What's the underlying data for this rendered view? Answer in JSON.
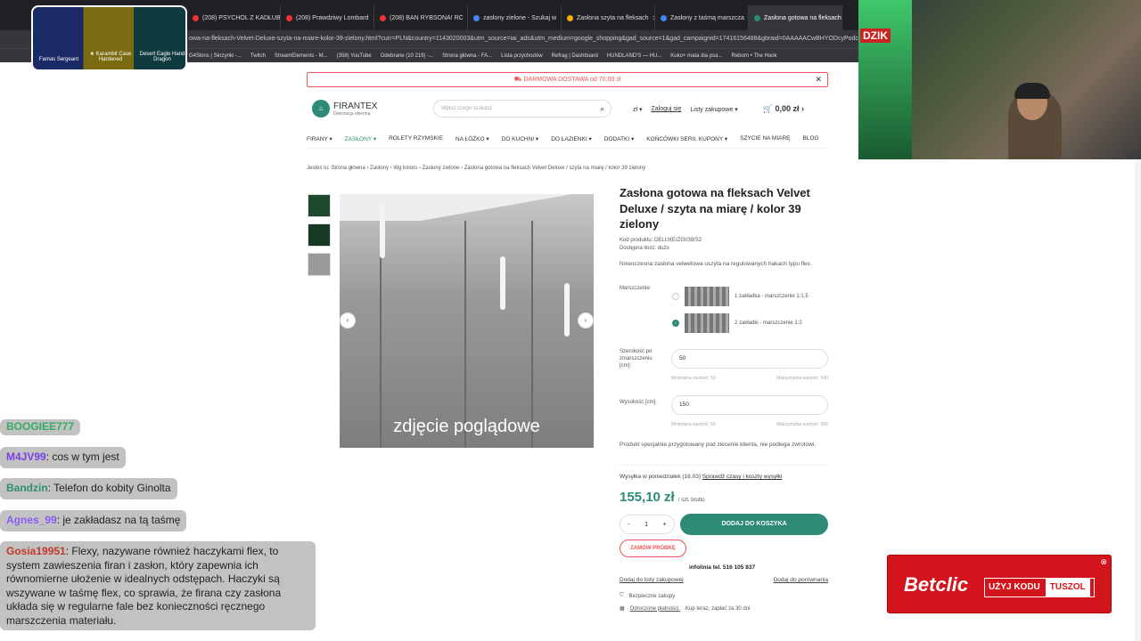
{
  "browser": {
    "tabs": [
      {
        "label": "(208) PSYCHOL Z KADŁUB",
        "color": "#e33"
      },
      {
        "label": "(208) Prawdziwy Lombard",
        "color": "#e33"
      },
      {
        "label": "(208) BAN RYBSONA! RC",
        "color": "#e33"
      },
      {
        "label": "zasłony zielone - Szukaj w",
        "color": "#4285f4"
      },
      {
        "label": "Zasłona szyta na fleksach",
        "color": "#f9ab00"
      },
      {
        "label": "Zasłony z taśmą marszcza",
        "color": "#4285f4"
      },
      {
        "label": "Zasłona gotowa na fleksach",
        "color": "#2c8a77",
        "active": true
      }
    ],
    "url": "owa-na-fleksach-Velvet-Deluxe-szyta-na-miare-kolor-39-zielony.html?curr=PLN&country=1143020003&utm_source=iai_ads&utm_medium=google_shopping&gad_source=1&gad_campaignid=17416156488&gbraid=0AAAAACwBHYODcyPodc",
    "bookmarks": [
      "G4Skins | Skrzynki -...",
      "Twitch",
      "StreamElements - M...",
      "(358) YouTube",
      "Odebrane (10 219) -...",
      "Strona główna - FA...",
      "Lista przychodów",
      "Refrag | Dashboard",
      "HUNDLAND'S — HU...",
      "Kuko+ mata dla psa...",
      "Reborn • The Hook"
    ]
  },
  "overlay": {
    "skins": [
      "Famas Sergeant",
      "★ Karambit Case Hardened",
      "Desert Eagle Hand Dragon"
    ]
  },
  "webcam": {
    "logo": "DZIK"
  },
  "site": {
    "promo": "DARMOWA DOSTAWA od 70,00 zł",
    "brand": "FIRANTEX",
    "brand_sub": "Dekoracja okienna",
    "search_placeholder": "Wpisz czego szukasz",
    "currency": "zł",
    "login": "Zaloguj się",
    "wishlists": "Listy zakupowe",
    "cart_total": "0,00 zł",
    "menu": [
      "FIRANY",
      "ZASŁONY",
      "ROLETY RZYMSKIE",
      "NA ŁÓŻKO",
      "DO KUCHNI",
      "DO ŁAZIENKI",
      "DODATKI",
      "KOŃCÓWKI SERII, KUPONY",
      "SZYCIE NA MIARĘ",
      "BLOG"
    ],
    "breadcrumb": "Jesteś tu:  Strona główna  ›  Zasłony  ›  Wg koloru  ›  Zasłony zielone  ›  Zasłona gotowa na fleksach Velvet Deluxe / szyta na miarę / kolor 39 zielony"
  },
  "product": {
    "image_caption": "zdjęcie poglądowe",
    "title": "Zasłona gotowa na fleksach Velvet Deluxe / szyta na miarę / kolor 39 zielony",
    "code": "Kod produktu: DELUXE/ZGI/39/S2",
    "availability": "Dostępna ilość: dużo",
    "description": "Nowoczesna zasłona velwetowa uszyta na regulowanych hakach typu flex.",
    "gather_label": "Marszczenie:",
    "gather_options": [
      {
        "label": "1 zakładka - marszczenie 1:1,5",
        "selected": false
      },
      {
        "label": "2 zakładki - marszczenie 1:2",
        "selected": true
      }
    ],
    "width_label": "Szerokość po zmarszczeniu [cm]:",
    "width_value": "50",
    "width_min": "Minimalna wartość: 50",
    "width_max": "Maksymalna wartość: 540",
    "height_label": "Wysokość [cm]:",
    "height_value": "150",
    "height_min": "Minimalna wartość: 50",
    "height_max": "Maksymalna wartość: 350",
    "special": "Produkt specjalnie przygotowany pod zlecenie klienta, nie podlega zwrotowi.",
    "shipping": "Wysyłka w poniedziałek (16.03)",
    "shipping_link": "Sprawdź czasy i koszty wysyłki",
    "price": "155,10 zł",
    "price_unit": "/ szt. brutto",
    "qty": "1",
    "add_to_cart": "DODAJ DO KOSZYKA",
    "order_sample": "ZAMÓW PRÓBKĘ",
    "hotline": "infolinia tel. 516 105 837",
    "add_list": "Dodaj do listy zakupowej",
    "add_compare": "Dodaj do porównania",
    "feature1": "Bezpieczne zakupy",
    "feature2_link": "Odroczone płatności.",
    "feature2": "Kup teraz, zapłać za 30 dni"
  },
  "chat": [
    {
      "user": "BOOGIEE777",
      "text": "",
      "color": "#3a6"
    },
    {
      "user": "M4JV99",
      "text": "cos w tym jest",
      "color": "#7b3fe4"
    },
    {
      "user": "Bandzin",
      "text": "Telefon do kobity Ginolta",
      "color": "#2f8f6f"
    },
    {
      "user": "Agnes_99",
      "text": "je zakładasz na tą taśmę",
      "color": "#8a5cf5"
    },
    {
      "user": "Gosia19951",
      "text": "Flexy, nazywane również haczykami flex, to system zawieszenia firan i zasłon, który zapewnia ich równomierne ułożenie w idealnych odstępach. Haczyki są wszywane w taśmę flex, co sprawia, że firana czy zasłona układa się w regularne fale bez konieczności ręcznego marszczenia materiału.",
      "color": "#c0392b"
    }
  ],
  "ad": {
    "brand": "Betclic",
    "cta": "UŻYJ KODU",
    "code": "TUSZOL"
  }
}
